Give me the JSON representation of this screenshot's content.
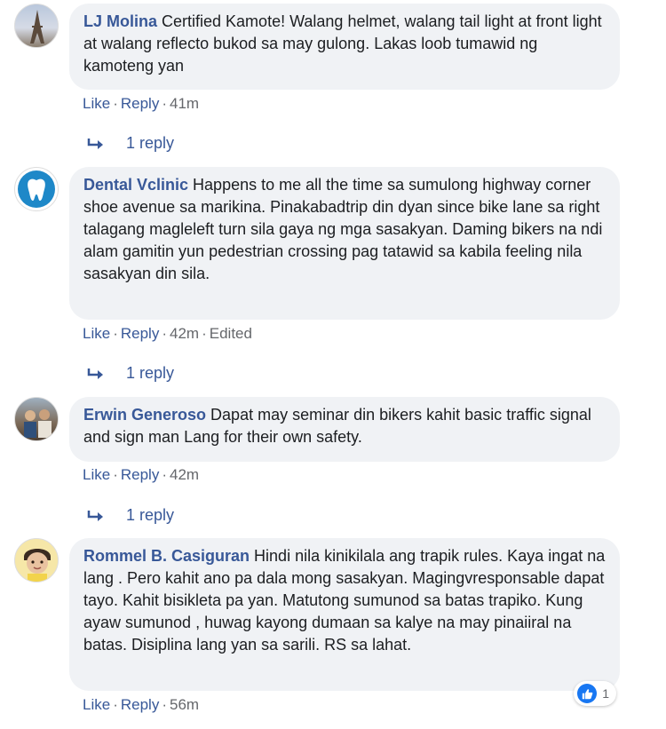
{
  "comments": [
    {
      "author": "LJ Molina",
      "text": "Certified Kamote! Walang helmet, walang tail light at front light at walang reflecto bukod sa may gulong. Lakas loob tumawid ng kamoteng yan",
      "like_label": "Like",
      "reply_label": "Reply",
      "time": "41m",
      "replies_label": "1 reply",
      "avatar_icon": "eiffel-tower-photo"
    },
    {
      "author": "Dental Vclinic",
      "text": "Happens to me all the time sa sumulong highway corner shoe avenue sa marikina. Pinakabadtrip din dyan since bike lane sa right talagang magleleft turn sila gaya ng mga sasakyan. Daming bikers na ndi alam gamitin yun pedestrian crossing pag tatawid sa kabila feeling nila sasakyan din sila.",
      "like_label": "Like",
      "reply_label": "Reply",
      "time": "42m",
      "edited_label": "Edited",
      "replies_label": "1 reply",
      "avatar_icon": "tooth-logo"
    },
    {
      "author": "Erwin Generoso",
      "text": "Dapat may seminar din bikers kahit basic traffic signal and sign man Lang for their own safety.",
      "like_label": "Like",
      "reply_label": "Reply",
      "time": "42m",
      "replies_label": "1 reply",
      "avatar_icon": "people-photo"
    },
    {
      "author": "Rommel B. Casiguran",
      "text": "Hindi nila kinikilala ang trapik rules. Kaya ingat na lang . Pero kahit ano pa dala mong sasakyan. Magingvresponsable dapat tayo. Kahit bisikleta pa yan. Matutong sumunod sa batas trapiko. Kung ayaw sumunod , huwag kayong dumaan sa kalye na may pinaiiral na batas. Disiplina lang yan sa sarili. RS sa lahat.",
      "like_label": "Like",
      "reply_label": "Reply",
      "time": "56m",
      "reaction_count": "1",
      "reaction_icon": "like-thumb-icon",
      "avatar_icon": "child-photo"
    }
  ],
  "colors": {
    "link": "#385898",
    "bubble": "#f0f2f5",
    "meta": "#65676b",
    "like_blue": "#1877f2"
  }
}
